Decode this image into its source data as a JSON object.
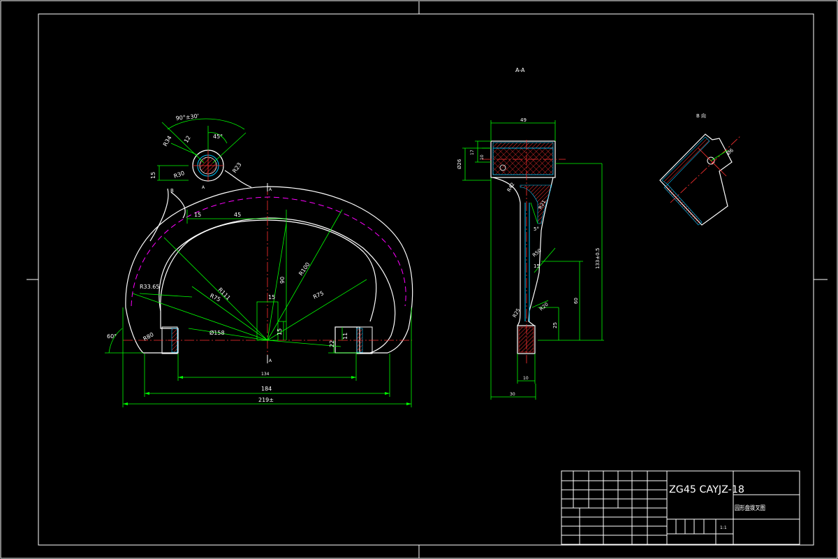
{
  "views": {
    "section_aa_label": "A-A",
    "view_b_label": "B 向"
  },
  "dimensions": {
    "front": {
      "angle_top": "90°±30'",
      "angle_45": "45°",
      "r34": "R34",
      "r12": "12",
      "r30": "R30",
      "r23": "R23",
      "h15": "15",
      "w15": "15",
      "w45": "45",
      "r3365": "R33.65",
      "r111": "R111",
      "r75_left": "R75",
      "r90": "90",
      "r100": "R100",
      "r75_right": "R75",
      "c15_top": "15",
      "c15_side": "15",
      "d158": "Ø158",
      "d22": "22",
      "d11": "11",
      "r80": "R80",
      "angle_60": "60°",
      "w134": "134",
      "w184": "184",
      "w219": "219±",
      "label_a_top": "A",
      "label_a_bottom": "A",
      "label_a_hub": "A",
      "label_b": "B"
    },
    "section": {
      "w49": "49",
      "d26": "Ø26",
      "h17": "17",
      "h10": "10",
      "r42": "R42",
      "r21": "R21",
      "w5": "5°",
      "r50": "R50",
      "v15": "15",
      "v60": "60",
      "r20": "R20",
      "v25": "25",
      "r25": "R25",
      "h133": "133±0.5",
      "w10": "10",
      "w30": "30"
    },
    "view_b": {
      "d6": "Ø6"
    }
  },
  "title_block": {
    "material_code": "ZG45    CAYJZ-18",
    "part_name": "园形盘拨叉图",
    "scale": "1:1"
  }
}
